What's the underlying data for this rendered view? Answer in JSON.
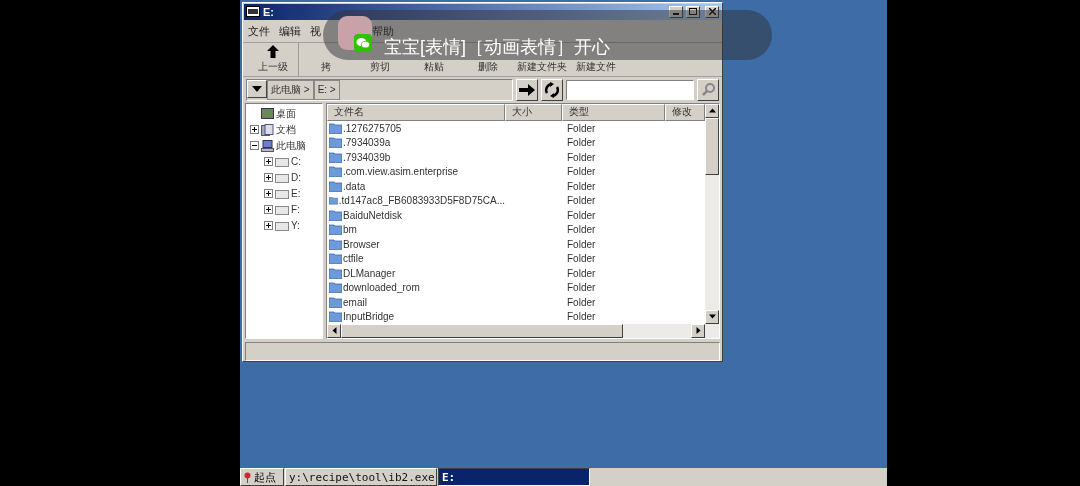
{
  "window": {
    "title": "E:"
  },
  "menu": [
    {
      "label": "文件"
    },
    {
      "label": "编辑"
    },
    {
      "label": "视"
    },
    {
      "label": "帮助"
    }
  ],
  "toolbar": [
    {
      "label": "上一级",
      "kind": "up"
    },
    {
      "label": "拷",
      "kind": "plain"
    },
    {
      "label": "剪切",
      "kind": "plain"
    },
    {
      "label": "粘贴",
      "kind": "plain"
    },
    {
      "label": "删除",
      "kind": "plain"
    },
    {
      "label": "新建文件夹",
      "kind": "plain"
    },
    {
      "label": "新建文件",
      "kind": "plain"
    }
  ],
  "address": {
    "crumbs": [
      "此电脑 >",
      "E: >"
    ]
  },
  "tree": [
    {
      "label": "桌面",
      "kind": "desktop"
    },
    {
      "label": "文档",
      "kind": "docs",
      "expanded": false
    },
    {
      "label": "此电脑",
      "kind": "pc",
      "expanded": true,
      "children": [
        {
          "label": "C:",
          "kind": "drive",
          "expanded": false
        },
        {
          "label": "D:",
          "kind": "drive",
          "expanded": false
        },
        {
          "label": "E:",
          "kind": "drive",
          "expanded": false
        },
        {
          "label": "F:",
          "kind": "drive",
          "expanded": false
        },
        {
          "label": "Y:",
          "kind": "drive",
          "expanded": false
        }
      ]
    }
  ],
  "table": {
    "columns": [
      "文件名",
      "大小",
      "类型",
      "修改"
    ],
    "rows": [
      {
        "name": ".1276275705",
        "type": "Folder"
      },
      {
        "name": ".7934039a",
        "type": "Folder"
      },
      {
        "name": ".7934039b",
        "type": "Folder"
      },
      {
        "name": ".com.view.asim.enterprise",
        "type": "Folder"
      },
      {
        "name": ".data",
        "type": "Folder"
      },
      {
        "name": ".td147ac8_FB6083933D5F8D75CA...",
        "type": "Folder"
      },
      {
        "name": "BaiduNetdisk",
        "type": "Folder"
      },
      {
        "name": "bm",
        "type": "Folder"
      },
      {
        "name": "Browser",
        "type": "Folder"
      },
      {
        "name": "ctfile",
        "type": "Folder"
      },
      {
        "name": "DLManager",
        "type": "Folder"
      },
      {
        "name": "downloaded_rom",
        "type": "Folder"
      },
      {
        "name": "email",
        "type": "Folder"
      },
      {
        "name": "InputBridge",
        "type": "Folder"
      }
    ]
  },
  "notification": {
    "text": "宝宝[表情]［动画表情］开心"
  },
  "taskbar": {
    "start": "起点",
    "tasks": [
      {
        "label": "y:\\recipe\\tool\\ib2.exe",
        "selected": false
      },
      {
        "label": "E:",
        "selected": true
      }
    ]
  }
}
